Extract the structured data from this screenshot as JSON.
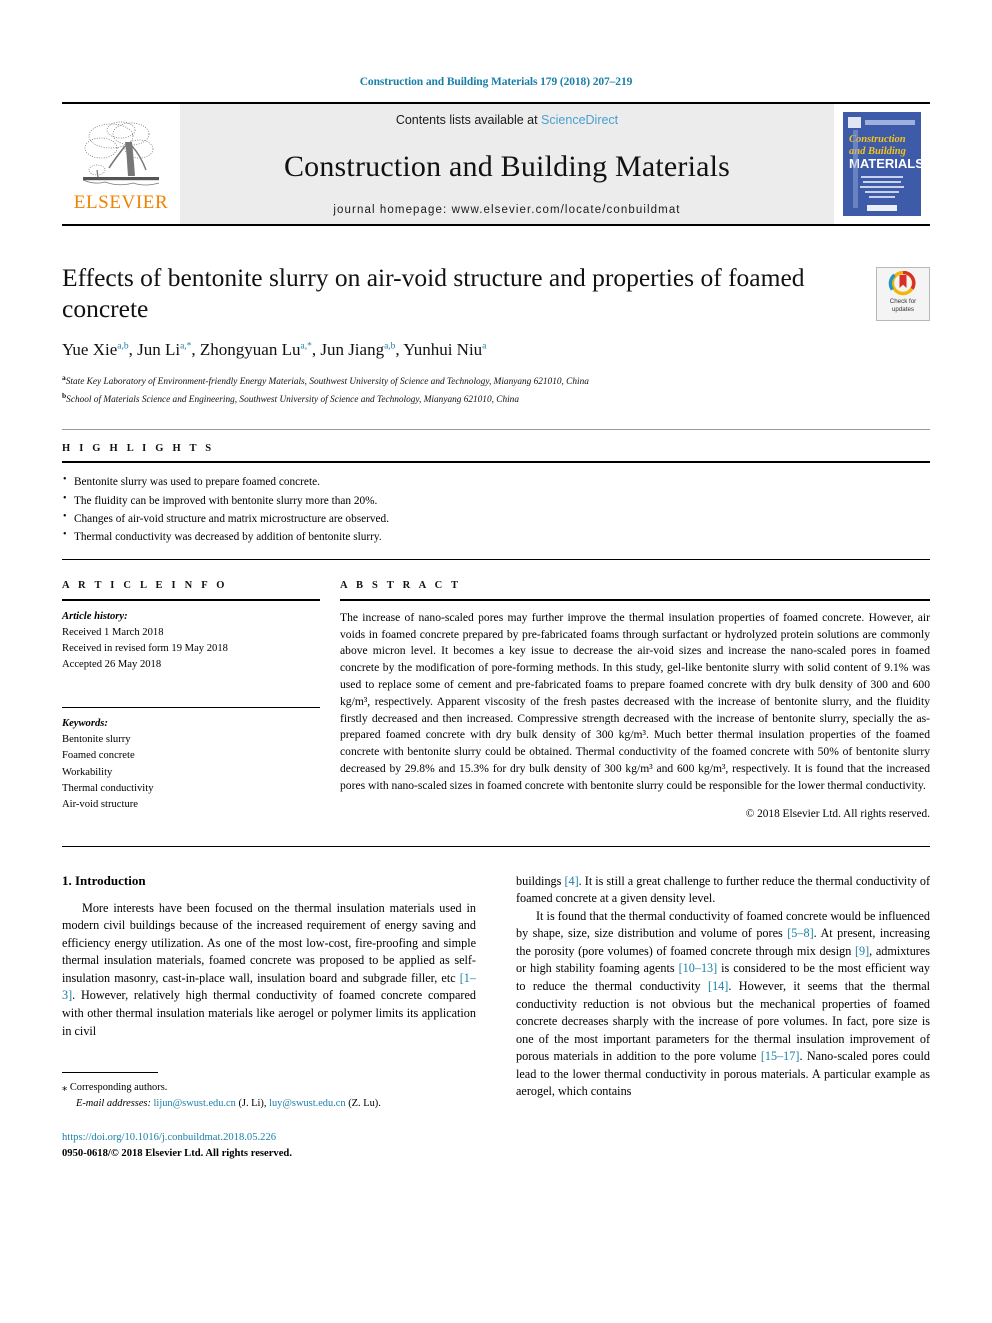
{
  "running_head": "Construction and Building Materials 179 (2018) 207–219",
  "colors": {
    "link": "#1a7fa8",
    "sciencedirect": "#4a9fd0",
    "elsevier_orange": "#ef8200",
    "band_gray": "#ececec",
    "cover_blue": "#3e5ba9"
  },
  "masthead": {
    "publisher_name": "ELSEVIER",
    "contents_prefix": "Contents lists available at ",
    "sciencedirect": "ScienceDirect",
    "journal_title": "Construction and Building Materials",
    "homepage": "journal homepage: www.elsevier.com/locate/conbuildmat",
    "cover": {
      "line1": "Construction",
      "line2": "and Building",
      "line3": "MATERIALS"
    }
  },
  "article": {
    "title": "Effects of bentonite slurry on air-void structure and properties of foamed concrete",
    "crossmark": {
      "line1": "Check for",
      "line2": "updates"
    },
    "authors": [
      {
        "name": "Yue Xie",
        "sup": "a,b",
        "sep": ", "
      },
      {
        "name": "Jun Li",
        "sup": "a,*",
        "sep": ", "
      },
      {
        "name": "Zhongyuan Lu",
        "sup": "a,*",
        "sep": ", "
      },
      {
        "name": "Jun Jiang",
        "sup": "a,b",
        "sep": ", "
      },
      {
        "name": "Yunhui Niu",
        "sup": "a",
        "sep": ""
      }
    ],
    "affiliations": [
      {
        "marker": "a",
        "text": "State Key Laboratory of Environment-friendly Energy Materials, Southwest University of Science and Technology, Mianyang 621010, China"
      },
      {
        "marker": "b",
        "text": "School of Materials Science and Engineering, Southwest University of Science and Technology, Mianyang 621010, China"
      }
    ]
  },
  "highlights": {
    "heading": "H I G H L I G H T S",
    "items": [
      "Bentonite slurry was used to prepare foamed concrete.",
      "The fluidity can be improved with bentonite slurry more than 20%.",
      "Changes of air-void structure and matrix microstructure are observed.",
      "Thermal conductivity was decreased by addition of bentonite slurry."
    ]
  },
  "article_info": {
    "heading": "A R T I C L E   I N F O",
    "history_label": "Article history:",
    "history": [
      "Received 1 March 2018",
      "Received in revised form 19 May 2018",
      "Accepted 26 May 2018"
    ],
    "keywords_label": "Keywords:",
    "keywords": [
      "Bentonite slurry",
      "Foamed concrete",
      "Workability",
      "Thermal conductivity",
      "Air-void structure"
    ]
  },
  "abstract": {
    "heading": "A B S T R A C T",
    "text": "The increase of nano-scaled pores may further improve the thermal insulation properties of foamed concrete. However, air voids in foamed concrete prepared by pre-fabricated foams through surfactant or hydrolyzed protein solutions are commonly above micron level. It becomes a key issue to decrease the air-void sizes and increase the nano-scaled pores in foamed concrete by the modification of pore-forming methods. In this study, gel-like bentonite slurry with solid content of 9.1% was used to replace some of cement and pre-fabricated foams to prepare foamed concrete with dry bulk density of 300 and 600 kg/m³, respectively. Apparent viscosity of the fresh pastes decreased with the increase of bentonite slurry, and the fluidity firstly decreased and then increased. Compressive strength decreased with the increase of bentonite slurry, specially the as-prepared foamed concrete with dry bulk density of 300 kg/m³. Much better thermal insulation properties of the foamed concrete with bentonite slurry could be obtained. Thermal conductivity of the foamed concrete with 50% of bentonite slurry decreased by 29.8% and 15.3% for dry bulk density of 300 kg/m³ and 600 kg/m³, respectively. It is found that the increased pores with nano-scaled sizes in foamed concrete with bentonite slurry could be responsible for the lower thermal conductivity.",
    "copyright": "© 2018 Elsevier Ltd. All rights reserved."
  },
  "introduction": {
    "heading": "1. Introduction",
    "left_para_1_a": "More interests have been focused on the thermal insulation materials used in modern civil buildings because of the increased requirement of energy saving and efficiency energy utilization. As one of the most low-cost, fire-proofing and simple thermal insulation materials, foamed concrete was proposed to be applied as self-insulation masonry, cast-in-place wall, insulation board and subgrade filler, etc ",
    "left_ref_1": "[1–3]",
    "left_para_1_b": ". However, relatively high thermal conductivity of foamed concrete compared with other thermal insulation materials like aerogel or polymer limits its application in civil",
    "right_para_1_a": "buildings ",
    "right_ref_1": "[4]",
    "right_para_1_b": ". It is still a great challenge to further reduce the thermal conductivity of foamed concrete at a given density level.",
    "right_para_2_a": "It is found that the thermal conductivity of foamed concrete would be influenced by shape, size, size distribution and volume of pores ",
    "right_ref_2": "[5–8]",
    "right_para_2_b": ". At present, increasing the porosity (pore volumes) of foamed concrete through mix design ",
    "right_ref_3": "[9]",
    "right_para_2_c": ", admixtures or high stability foaming agents ",
    "right_ref_4": "[10–13]",
    "right_para_2_d": " is considered to be the most efficient way to reduce the thermal conductivity ",
    "right_ref_5": "[14]",
    "right_para_2_e": ". However, it seems that the thermal conductivity reduction is not obvious but the mechanical properties of foamed concrete decreases sharply with the increase of pore volumes. In fact, pore size is one of the most important parameters for the thermal insulation improvement of porous materials in addition to the pore volume ",
    "right_ref_6": "[15–17]",
    "right_para_2_f": ". Nano-scaled pores could lead to the lower thermal conductivity in porous materials. A particular example as aerogel, which contains"
  },
  "footnote": {
    "star": "⁎",
    "corresponding": "Corresponding authors.",
    "email_label": "E-mail addresses:",
    "email_1": "lijun@swust.edu.cn",
    "email_1_owner": "(J. Li)",
    "email_2": "luy@swust.edu.cn",
    "email_2_owner": "(Z. Lu)"
  },
  "imprint": {
    "doi": "https://doi.org/10.1016/j.conbuildmat.2018.05.226",
    "issn_line": "0950-0618/© 2018 Elsevier Ltd. All rights reserved."
  }
}
